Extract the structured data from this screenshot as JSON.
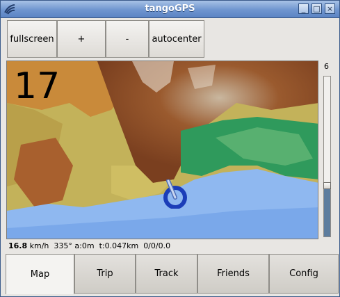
{
  "window": {
    "title": "tangoGPS",
    "controls": {
      "minimize": "_",
      "maximize": "□",
      "close": "×"
    }
  },
  "toolbar": {
    "fullscreen_label": "fullscreen",
    "zoom_in_label": "+",
    "zoom_out_label": "-",
    "autocenter_label": "autocenter"
  },
  "map": {
    "zoom_level": "17",
    "zoom_slider_max_label": "6",
    "zoom_slider_level_fraction": 0.3
  },
  "status": {
    "speed": "16.8",
    "speed_unit": " km/h",
    "heading": "335°",
    "altitude": "a:0m",
    "trip": "t:0.047km",
    "sats": "0/0/0.0"
  },
  "tabs": [
    "Map",
    "Trip",
    "Track",
    "Friends",
    "Config"
  ],
  "colors": {
    "titlebar": "#6f95cf",
    "sea": "#8fb8f0",
    "lowland": "#2f9a5c",
    "mountain": "#8b4a26",
    "marker": "#1b3db8",
    "slider_fill": "#5d7d9e"
  }
}
